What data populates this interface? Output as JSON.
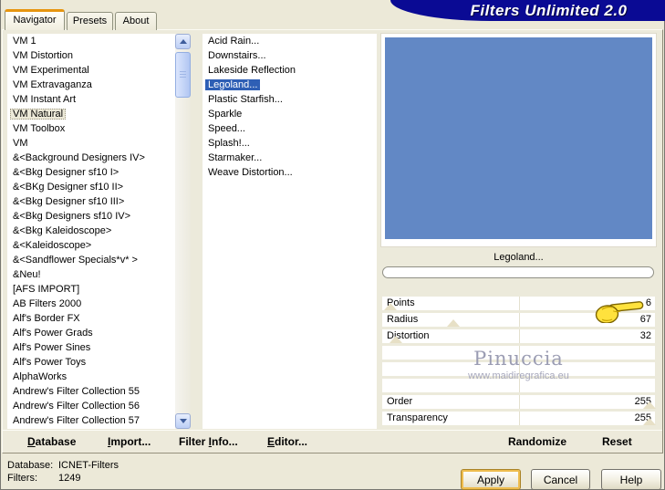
{
  "window": {
    "title": "Filters Unlimited 2.0"
  },
  "tabs": [
    {
      "label": "Navigator",
      "active": true
    },
    {
      "label": "Presets",
      "active": false
    },
    {
      "label": "About",
      "active": false
    }
  ],
  "category_list": {
    "selected": "VM Natural",
    "items": [
      "VM 1",
      "VM Distortion",
      "VM Experimental",
      "VM Extravaganza",
      "VM Instant Art",
      "VM Natural",
      "VM Toolbox",
      "VM",
      "&<Background Designers IV>",
      "&<Bkg Designer sf10 I>",
      "&<BKg Designer sf10 II>",
      "&<Bkg Designer sf10 III>",
      "&<Bkg Designers sf10 IV>",
      "&<Bkg Kaleidoscope>",
      "&<Kaleidoscope>",
      "&<Sandflower Specials*v* >",
      "&Neu!",
      "[AFS IMPORT]",
      "AB Filters 2000",
      "Alf's Border FX",
      "Alf's Power Grads",
      "Alf's Power Sines",
      "Alf's Power Toys",
      "AlphaWorks",
      "Andrew's Filter Collection 55",
      "Andrew's Filter Collection 56",
      "Andrew's Filter Collection 57"
    ]
  },
  "filter_list": {
    "selected": "Legoland...",
    "items": [
      "Acid Rain...",
      "Downstairs...",
      "Lakeside Reflection",
      "Legoland...",
      "Plastic Starfish...",
      "Sparkle",
      "Speed...",
      "Splash!...",
      "Starmaker...",
      "Weave Distortion..."
    ]
  },
  "preview": {
    "caption": "Legoland...",
    "color": "#6288c5"
  },
  "sliders": {
    "rows": [
      {
        "label": "Points",
        "value": "6",
        "thumb_pct": 3
      },
      {
        "label": "Radius",
        "value": "67",
        "thumb_pct": 26
      },
      {
        "label": "Distortion",
        "value": "32",
        "thumb_pct": 5
      },
      {
        "label": "",
        "value": "",
        "thumb_pct": null
      },
      {
        "label": "",
        "value": "",
        "thumb_pct": null
      },
      {
        "label": "",
        "value": "",
        "thumb_pct": null
      },
      {
        "label": "Order",
        "value": "255",
        "thumb_pct": 98
      },
      {
        "label": "Transparency",
        "value": "255",
        "thumb_pct": 98
      }
    ]
  },
  "watermark": {
    "line1": "Pinuccia",
    "line2": "www.maidiregrafica.eu"
  },
  "toolbar": {
    "items": [
      {
        "name": "database-button",
        "pre": "",
        "mnemonic": "D",
        "post": "atabase"
      },
      {
        "name": "import-button",
        "pre": "",
        "mnemonic": "I",
        "post": "mport..."
      },
      {
        "name": "filter-info-button",
        "pre": "Filter ",
        "mnemonic": "I",
        "post": "nfo..."
      },
      {
        "name": "editor-button",
        "pre": "",
        "mnemonic": "E",
        "post": "ditor..."
      }
    ],
    "randomize_label": "Randomize",
    "reset_label": "Reset"
  },
  "status": {
    "database_label": "Database:",
    "database_value": "ICNET-Filters",
    "filters_label": "Filters:",
    "filters_value": "1249"
  },
  "buttons": {
    "apply": "Apply",
    "cancel": "Cancel",
    "help": "Help"
  },
  "colors": {
    "dialog_bg": "#ece9d8",
    "banner": "#0a0a94",
    "selection": "#2e5fb5",
    "preview_blue": "#6288c5",
    "active_tab_accent": "#e6950f",
    "watermark_gray": "#9b9db3"
  }
}
